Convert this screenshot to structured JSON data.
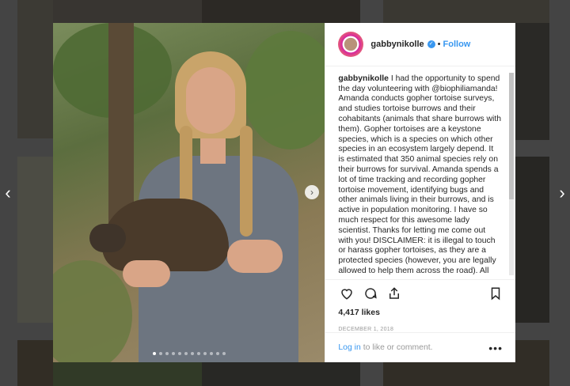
{
  "post": {
    "username": "gabbynikolle",
    "verified_icon": "verified-badge-icon",
    "separator": "•",
    "follow_label": "Follow",
    "caption_username": "gabbynikolle",
    "caption_text": "I had the opportunity to spend the day volunteering with @biophiliamanda! Amanda conducts gopher tortoise surveys, and studies tortoise burrows and their cohabitants (animals that share burrows with them). Gopher tortoises are a keystone species, which is a species on which other species in an ecosystem largely depend. It is estimated that 350 animal species rely on their burrows for survival. Amanda spends a lot of time tracking and recording gopher tortoise movement, identifying bugs and other animals living in their burrows, and is active in population monitoring. I have so much respect for this awesome lady scientist. Thanks for letting me come out with you! DISCLAIMER: it is illegal to touch or harass gopher tortoises, as they are a protected species (however, you are legally allowed to help them across the road). All",
    "likes": "4,417 likes",
    "date": "DECEMBER 1, 2018",
    "login_label": "Log in",
    "login_suffix": "to like or comment.",
    "more_label": "•••",
    "carousel_total": 12,
    "carousel_active": 0
  },
  "nav": {
    "prev_label": "‹",
    "next_label": "›",
    "photo_next_label": "›"
  },
  "icons": {
    "like": "heart-icon",
    "comment": "comment-icon",
    "share": "share-icon",
    "save": "bookmark-icon"
  },
  "colors": {
    "accent": "#3897f0",
    "text": "#262626",
    "muted": "#999999"
  }
}
